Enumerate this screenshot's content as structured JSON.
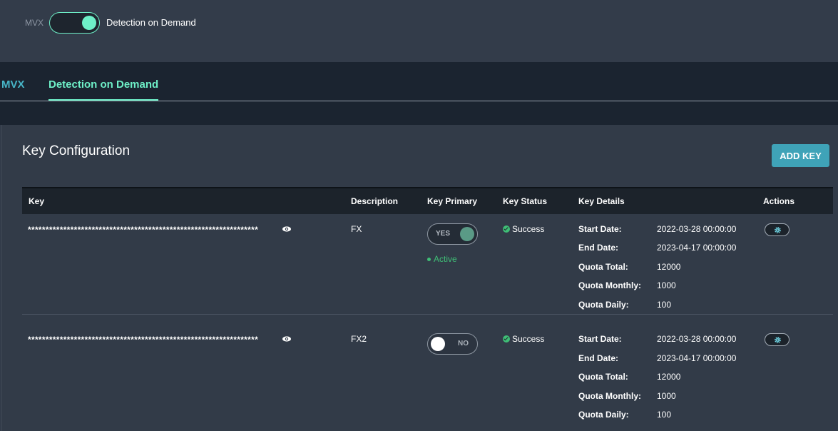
{
  "top": {
    "mvx_label": "MVX",
    "toggle_label": "Detection on Demand"
  },
  "tabs": [
    {
      "label": "MVX",
      "active": false
    },
    {
      "label": "Detection on Demand",
      "active": true
    }
  ],
  "panel": {
    "title": "Key Configuration",
    "add_key_label": "ADD KEY"
  },
  "table": {
    "headers": [
      "Key",
      "Description",
      "Key Primary",
      "Key Status",
      "Key Details",
      "Actions"
    ],
    "detail_labels": [
      "Start Date:",
      "End Date:",
      "Quota Total:",
      "Quota Monthly:",
      "Quota Daily:"
    ],
    "rows": [
      {
        "key": "*****************************************************************",
        "description": "FX",
        "primary_label": "YES",
        "primary_on": true,
        "active_label": "Active",
        "status": "Success",
        "start_date": "2022-03-28 00:00:00",
        "end_date": "2023-04-17 00:00:00",
        "quota_total": "12000",
        "quota_monthly": "1000",
        "quota_daily": "100"
      },
      {
        "key": "*****************************************************************",
        "description": "FX2",
        "primary_label": "NO",
        "primary_on": false,
        "status": "Success",
        "start_date": "2022-03-28 00:00:00",
        "end_date": "2023-04-17 00:00:00",
        "quota_total": "12000",
        "quota_monthly": "1000",
        "quota_daily": "100"
      }
    ]
  },
  "colors": {
    "accent": "#6ef0c8",
    "tab_inactive": "#47b5c7",
    "button": "#3fa3b8",
    "success": "#3fbe76"
  },
  "icons": [
    "eye-icon",
    "gear-icon",
    "success-check-icon"
  ]
}
